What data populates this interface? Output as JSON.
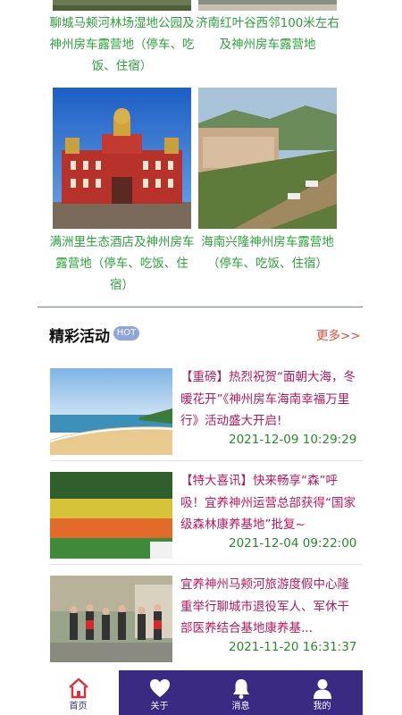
{
  "camps_top": [
    {
      "text": "聊城马颊河林场湿地公园及神州房车露营地（停车、吃饭、住宿）"
    },
    {
      "text": "济南红叶谷西邻100米左右及神州房车露营地"
    }
  ],
  "camps": [
    {
      "text": "满洲里生态酒店及神州房车露营地（停车、吃饭、住宿）"
    },
    {
      "text": "海南兴隆神州房车露营地（停车、吃饭、住宿）"
    }
  ],
  "activities": {
    "title": "精彩活动",
    "badge": "HOT",
    "more": "更多>>",
    "items": [
      {
        "title": "【重磅】热烈祝贺“面朝大海，冬暖花开”《神州房车海南幸福万里行》活动盛大开启!",
        "date": "2021-12-09 10:29:29"
      },
      {
        "title": "【特大喜讯】快来畅享“森”呼吸！宜养神州运营总部获得“国家级森林康养基地”批复~",
        "date": "2021-12-04 09:22:00"
      },
      {
        "title": "宜养神州马颊河旅游度假中心隆重举行聊城市退役军人、军休干部医养结合基地康养基...",
        "date": "2021-11-20 16:31:37"
      }
    ]
  },
  "tabbar": {
    "items": [
      {
        "label": "首页",
        "icon": "home-icon"
      },
      {
        "label": "关于",
        "icon": "heart-icon"
      },
      {
        "label": "消息",
        "icon": "bell-icon"
      },
      {
        "label": "我的",
        "icon": "user-icon"
      }
    ]
  },
  "colors": {
    "accent": "#3a2a82",
    "green": "#2aa33a",
    "title_red": "#b8195d",
    "more": "#e64a3a"
  }
}
